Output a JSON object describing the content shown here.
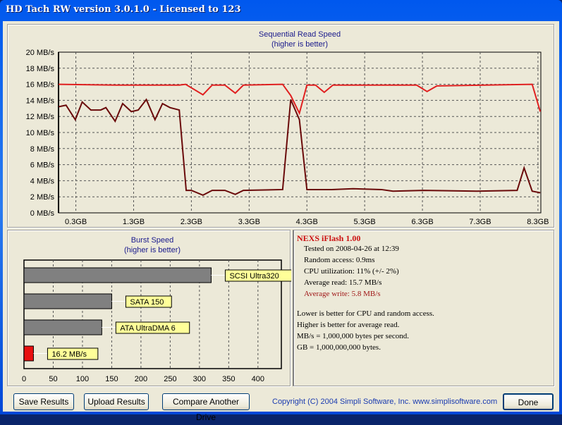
{
  "window": {
    "title": "HD Tach RW version 3.0.1.0 - Licensed to 123"
  },
  "chart_data": [
    {
      "type": "line",
      "title": "Sequential Read Speed",
      "subtitle": "(higher is better)",
      "xlim": [
        0,
        8.35
      ],
      "ylim": [
        0,
        20
      ],
      "grid": true,
      "yticks": [
        "0 MB/s",
        "2 MB/s",
        "4 MB/s",
        "6 MB/s",
        "8 MB/s",
        "10 MB/s",
        "12 MB/s",
        "14 MB/s",
        "16 MB/s",
        "18 MB/s",
        "20 MB/s"
      ],
      "xticks": [
        {
          "v": 0.3,
          "label": "0.3GB"
        },
        {
          "v": 1.3,
          "label": "1.3GB"
        },
        {
          "v": 2.3,
          "label": "2.3GB"
        },
        {
          "v": 3.3,
          "label": "3.3GB"
        },
        {
          "v": 4.3,
          "label": "4.3GB"
        },
        {
          "v": 5.3,
          "label": "5.3GB"
        },
        {
          "v": 6.3,
          "label": "6.3GB"
        },
        {
          "v": 7.3,
          "label": "7.3GB"
        },
        {
          "v": 8.3,
          "label": "8.3GB"
        }
      ],
      "series": [
        {
          "color": "#e02020",
          "points": [
            [
              0,
              16
            ],
            [
              1.0,
              15.9
            ],
            [
              2.09,
              15.9
            ],
            [
              2.2,
              16
            ],
            [
              2.5,
              14.7
            ],
            [
              2.66,
              15.9
            ],
            [
              2.88,
              15.9
            ],
            [
              3.06,
              14.9
            ],
            [
              3.2,
              15.9
            ],
            [
              3.88,
              16
            ],
            [
              4.02,
              14.6
            ],
            [
              4.17,
              12.4
            ],
            [
              4.3,
              15.9
            ],
            [
              4.45,
              15.9
            ],
            [
              4.6,
              15.0
            ],
            [
              4.75,
              15.9
            ],
            [
              6.2,
              15.9
            ],
            [
              6.38,
              15.1
            ],
            [
              6.55,
              15.8
            ],
            [
              8.2,
              16
            ],
            [
              8.34,
              12.6
            ]
          ]
        },
        {
          "color": "#6a0a0a",
          "points": [
            [
              0,
              13.2
            ],
            [
              0.13,
              13.4
            ],
            [
              0.29,
              11.6
            ],
            [
              0.41,
              13.8
            ],
            [
              0.56,
              12.8
            ],
            [
              0.73,
              12.8
            ],
            [
              0.82,
              13.1
            ],
            [
              0.98,
              11.4
            ],
            [
              1.11,
              13.6
            ],
            [
              1.26,
              12.6
            ],
            [
              1.38,
              12.8
            ],
            [
              1.52,
              14.1
            ],
            [
              1.67,
              11.6
            ],
            [
              1.8,
              13.6
            ],
            [
              1.93,
              13.1
            ],
            [
              2.09,
              12.8
            ],
            [
              2.21,
              2.8
            ],
            [
              2.3,
              2.8
            ],
            [
              2.5,
              2.2
            ],
            [
              2.66,
              2.8
            ],
            [
              2.88,
              2.8
            ],
            [
              3.06,
              2.3
            ],
            [
              3.2,
              2.8
            ],
            [
              3.88,
              2.9
            ],
            [
              4.02,
              14.1
            ],
            [
              4.17,
              11.6
            ],
            [
              4.3,
              2.9
            ],
            [
              4.73,
              2.9
            ],
            [
              5.1,
              3.0
            ],
            [
              5.59,
              2.9
            ],
            [
              5.79,
              2.7
            ],
            [
              6.32,
              2.8
            ],
            [
              7.24,
              2.7
            ],
            [
              7.94,
              2.8
            ],
            [
              8.06,
              5.6
            ],
            [
              8.2,
              2.7
            ],
            [
              8.34,
              2.5
            ]
          ]
        }
      ]
    },
    {
      "type": "bar",
      "orientation": "horizontal",
      "title": "Burst Speed",
      "subtitle": "(higher is better)",
      "xlim": [
        0,
        440
      ],
      "xticks": [
        0,
        50,
        100,
        150,
        200,
        250,
        300,
        350,
        400
      ],
      "grid": true,
      "bars": [
        {
          "label": "SCSI Ultra320",
          "value": 320,
          "color": "#808080"
        },
        {
          "label": "SATA 150",
          "value": 150,
          "color": "#808080"
        },
        {
          "label": "ATA UltraDMA 6",
          "value": 133,
          "color": "#808080"
        },
        {
          "label": "16.2 MB/s",
          "value": 16.2,
          "color": "#e81010"
        }
      ]
    }
  ],
  "info": {
    "drive": "NEXS iFlash 1.00",
    "tested": "Tested on 2008-04-26 at 12:39",
    "random": "Random access: 0.9ms",
    "cpu": "CPU utilization: 11% (+/- 2%)",
    "avg_read": "Average read: 15.7 MB/s",
    "avg_write": "Average write: 5.8 MB/s",
    "note1": "Lower is better for CPU and random access.",
    "note2": "Higher is better for average read.",
    "note3": "MB/s = 1,000,000 bytes per second.",
    "note4": "GB = 1,000,000,000 bytes."
  },
  "buttons": {
    "save": "Save Results",
    "upload": "Upload Results",
    "compare": "Compare Another Drive",
    "done": "Done"
  },
  "copyright": "Copyright (C) 2004 Simpli Software, Inc. www.simplisoftware.com"
}
